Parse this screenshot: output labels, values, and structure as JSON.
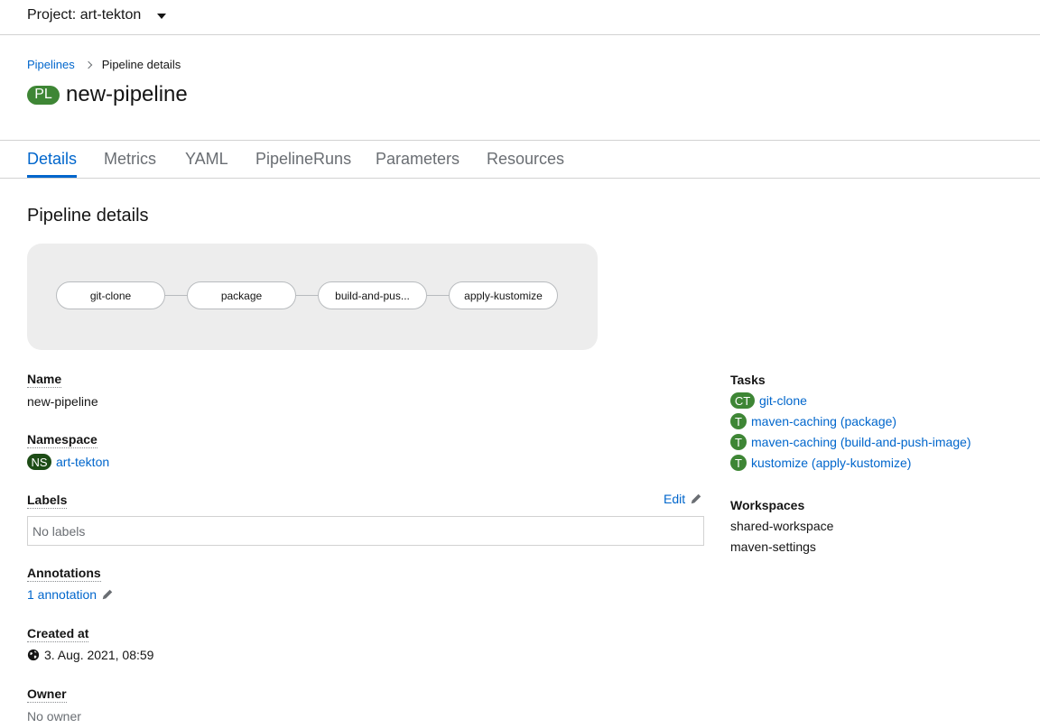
{
  "project": {
    "label": "Project: art-tekton"
  },
  "breadcrumb": {
    "parent": "Pipelines",
    "current": "Pipeline details"
  },
  "header": {
    "badge": "PL",
    "title": "new-pipeline"
  },
  "tabs": [
    {
      "label": "Details",
      "active": true
    },
    {
      "label": "Metrics"
    },
    {
      "label": "YAML"
    },
    {
      "label": "PipelineRuns"
    },
    {
      "label": "Parameters"
    },
    {
      "label": "Resources"
    }
  ],
  "section_title": "Pipeline details",
  "topology": {
    "nodes": [
      "git-clone",
      "package",
      "build-and-pus...",
      "apply-kustomize"
    ]
  },
  "details": {
    "name_label": "Name",
    "name_value": "new-pipeline",
    "namespace_label": "Namespace",
    "namespace_badge": "NS",
    "namespace_value": "art-tekton",
    "labels_label": "Labels",
    "labels_edit": "Edit",
    "labels_value": "No labels",
    "annotations_label": "Annotations",
    "annotations_value": "1 annotation",
    "created_label": "Created at",
    "created_value": "3. Aug. 2021, 08:59",
    "owner_label": "Owner",
    "owner_value": "No owner"
  },
  "tasks": {
    "label": "Tasks",
    "items": [
      {
        "badge": "CT",
        "name": "git-clone"
      },
      {
        "badge": "T",
        "name": "maven-caching (package)"
      },
      {
        "badge": "T",
        "name": "maven-caching (build-and-push-image)"
      },
      {
        "badge": "T",
        "name": "kustomize (apply-kustomize)"
      }
    ]
  },
  "workspaces": {
    "label": "Workspaces",
    "items": [
      "shared-workspace",
      "maven-settings"
    ]
  },
  "colors": {
    "link": "#0066cc",
    "badge_green": "#3e8635",
    "ns_badge": "#1d4c16"
  },
  "icons": {
    "caret": "caret-down-icon",
    "pencil": "pencil-icon",
    "globe": "globe-icon",
    "chevron": "chevron-right-icon"
  }
}
